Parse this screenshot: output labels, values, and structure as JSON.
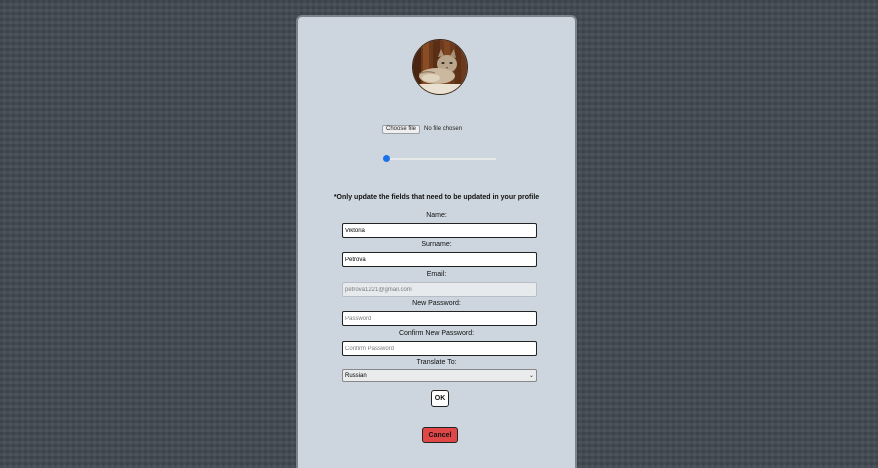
{
  "file_input": {
    "button_label": "Choose file",
    "status": "No file chosen"
  },
  "zoom_slider": {
    "value": 0
  },
  "notice": "*Only update the fields that need to be updated in your profile",
  "form": {
    "name": {
      "label": "Name:",
      "value": "Viktoria"
    },
    "surname": {
      "label": "Surname:",
      "value": "Petrova"
    },
    "email": {
      "label": "Email:",
      "placeholder": "petrova1221@gmail.com"
    },
    "new_password": {
      "label": "New Password:",
      "placeholder": "Password"
    },
    "confirm_password": {
      "label": "Confirm New Password:",
      "placeholder": "Confirm Password"
    },
    "translate": {
      "label": "Translate To:",
      "selected": "Russian"
    }
  },
  "buttons": {
    "ok": "OK",
    "cancel": "Cancel"
  },
  "colors": {
    "panel_background": "#cdd6de",
    "page_background": "#424a52",
    "cancel_button": "#e04848",
    "slider_accent": "#1a73e8"
  }
}
